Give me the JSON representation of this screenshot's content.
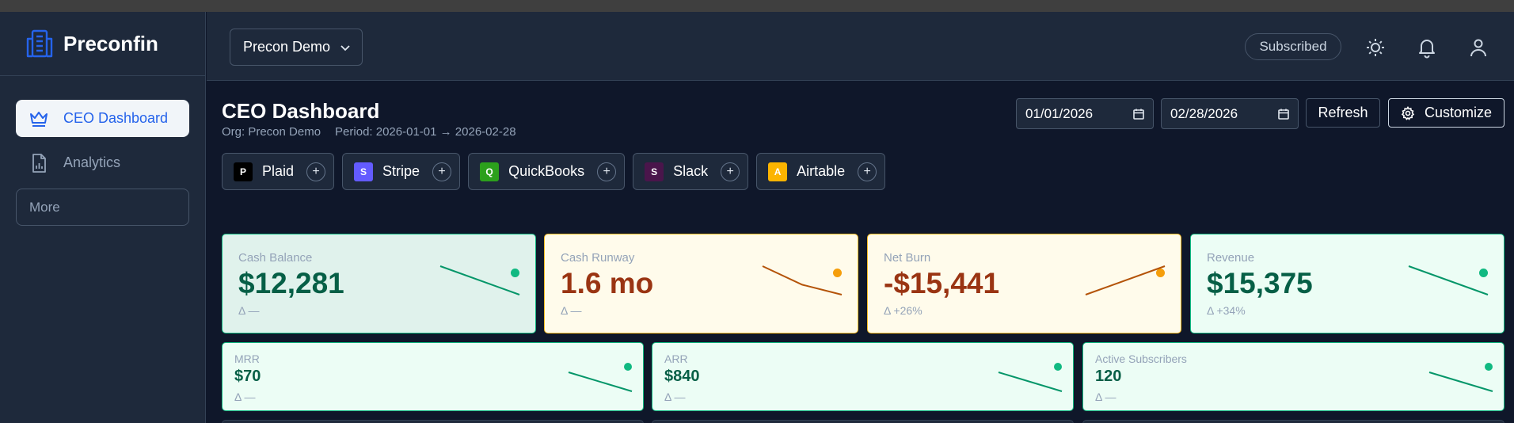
{
  "app": {
    "name": "Preconfin"
  },
  "sidebar": {
    "items": [
      {
        "label": "CEO Dashboard",
        "icon": "crown-icon",
        "active": true
      },
      {
        "label": "Analytics",
        "icon": "report-icon",
        "active": false
      }
    ],
    "more_label": "More"
  },
  "header": {
    "org_selector": "Precon Demo",
    "subscription_badge": "Subscribed",
    "icons": [
      "sun-icon",
      "bell-icon",
      "user-icon"
    ]
  },
  "page": {
    "title": "CEO Dashboard",
    "org_line": "Org: Precon Demo",
    "period_line": "Period: 2026-01-01 → 2026-02-28",
    "start_date": "01/01/2026",
    "end_date": "02/28/2026",
    "refresh_label": "Refresh",
    "customize_label": "Customize"
  },
  "integrations": [
    {
      "name": "Plaid",
      "letter": "P",
      "color": "#000000"
    },
    {
      "name": "Stripe",
      "letter": "S",
      "color": "#635bff"
    },
    {
      "name": "QuickBooks",
      "letter": "Q",
      "color": "#2ca01c"
    },
    {
      "name": "Slack",
      "letter": "S",
      "color": "#4a154b"
    },
    {
      "name": "Airtable",
      "letter": "A",
      "color": "#fcb400"
    }
  ],
  "kpis": [
    {
      "label": "Cash Balance",
      "value": "$12,281",
      "delta": "Δ —",
      "status": "good",
      "trend": [
        1,
        0
      ]
    },
    {
      "label": "Cash Runway",
      "value": "1.6 mo",
      "delta": "Δ —",
      "status": "warn",
      "trend": [
        1,
        0.35,
        0
      ]
    },
    {
      "label": "Net Burn",
      "value": "-$15,441",
      "delta": "Δ +26%",
      "status": "warn",
      "trend": [
        0,
        1
      ]
    },
    {
      "label": "Revenue",
      "value": "$15,375",
      "delta": "Δ +34%",
      "status": "good",
      "trend": [
        1,
        0
      ]
    }
  ],
  "kpis_secondary": [
    {
      "label": "MRR",
      "value": "$70",
      "delta": "Δ —",
      "status": "good",
      "trend": [
        1,
        0
      ]
    },
    {
      "label": "ARR",
      "value": "$840",
      "delta": "Δ —",
      "status": "good",
      "trend": [
        1,
        0
      ]
    },
    {
      "label": "Active Subscribers",
      "value": "120",
      "delta": "Δ —",
      "status": "good",
      "trend": [
        1,
        0
      ]
    }
  ],
  "colors": {
    "accent": "#2563eb",
    "good": "#10b981",
    "warn": "#f59e0b"
  }
}
